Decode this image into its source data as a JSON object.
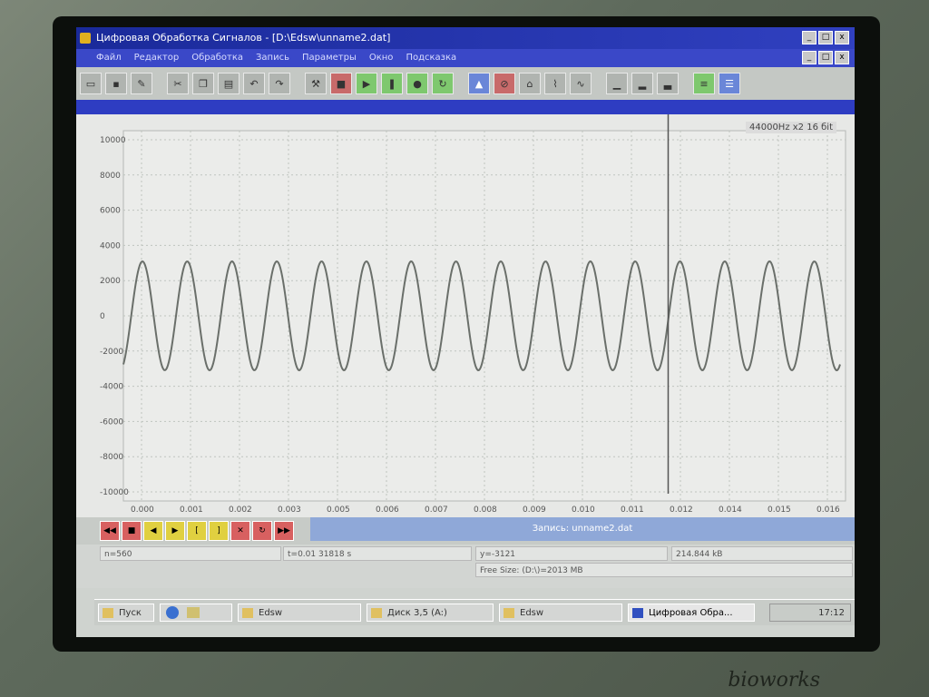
{
  "window": {
    "title": "Цифровая Обработка Сигналов - [D:\\Edsw\\unname2.dat]",
    "controls": [
      "_",
      "□",
      "x"
    ]
  },
  "menu": [
    "Файл",
    "Редактор",
    "Обработка",
    "Запись",
    "Параметры",
    "Окно",
    "Подсказка"
  ],
  "toolbar_icons": [
    "open-icon",
    "save-icon",
    "pen-icon",
    "cut-icon",
    "copy-icon",
    "paste-icon",
    "undo-icon",
    "redo-icon",
    "tool-icon",
    "stop-icon",
    "play-icon",
    "pause-icon",
    "record-icon",
    "loop-icon",
    "filter-icon",
    "no-icon",
    "scope-icon",
    "spectrum-icon",
    "wave-icon",
    "graph1-icon",
    "graph2-icon",
    "graph3-icon",
    "bars-icon",
    "window-icon"
  ],
  "plot": {
    "freq_label": "44000Hz x2 16 бit",
    "y_ticks": [
      "10000",
      "8000",
      "6000",
      "4000",
      "2000",
      "0",
      "-2000",
      "-4000",
      "-6000",
      "-8000",
      "-10000"
    ],
    "x_ticks": [
      "0.000",
      "0.001",
      "0.002",
      "0.003",
      "0.005",
      "0.006",
      "0.007",
      "0.008",
      "0.009",
      "0.010",
      "0.011",
      "0.012",
      "0.014",
      "0.015",
      "0.016"
    ]
  },
  "record_label": "Запись: unname2.dat",
  "info": {
    "n": "n=560",
    "t": "t=0.01 31818 s",
    "y": "y=-3121",
    "size": "214.844 kB",
    "free": "Free Size: (D:\\)=2013 MB"
  },
  "taskbar": {
    "start": "Пуск",
    "tasks": [
      "Edsw",
      "Диск 3,5 (A:)",
      "Edsw",
      "Цифровая Обра..."
    ],
    "clock": "17:12"
  },
  "brand": "bioworks",
  "colors": {
    "title": "#2030b0",
    "signal": "#6a6f6a",
    "grid": "#bfc4bf"
  }
}
